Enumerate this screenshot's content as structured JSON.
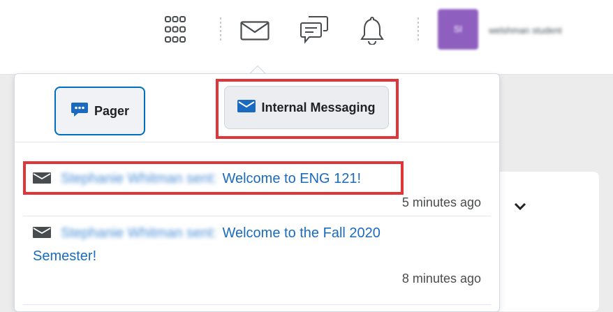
{
  "topbar": {
    "icons": [
      "waffle-grid-icon",
      "envelope-icon",
      "chat-bubbles-icon",
      "bell-icon"
    ],
    "avatar_initials": "SI",
    "username": "welshman student"
  },
  "dropdown": {
    "tabs": [
      {
        "label": "Pager",
        "icon": "chat-bubble-icon"
      },
      {
        "label": "Internal Messaging",
        "icon": "envelope-icon"
      }
    ],
    "messages": [
      {
        "sender": "Stephanie Whitman sent:",
        "subject": "Welcome to ENG 121!",
        "time": "5 minutes ago"
      },
      {
        "sender": "Stephanie Whitman sent:",
        "subject": "Welcome to the Fall 2020",
        "subject_cont": "Semester!",
        "time": "8 minutes ago"
      }
    ]
  },
  "colors": {
    "link": "#1a6bbf",
    "highlight": "#e0363a",
    "avatar": "#8e5fbf",
    "focus_border": "#006fbf"
  }
}
